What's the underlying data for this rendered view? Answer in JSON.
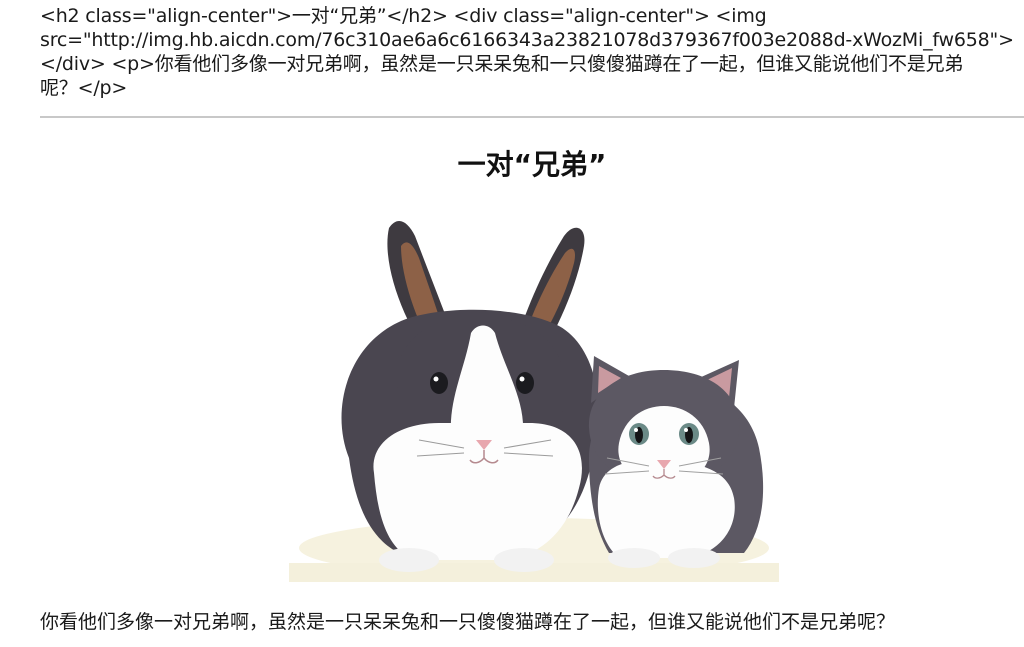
{
  "source": {
    "line1": "<h2 class=\"align-center\">一对“兄弟”</h2> <div class=\"align-center\"> <img",
    "line2": "src=\"http://img.hb.aicdn.com/76c310ae6a6c6166343a23821078d379367f003e2088d-xWozMi_fw658\">",
    "line3": "</div> <p>你看他们多像一对兄弟啊，虽然是一只呆呆兔和一只傻傻猫蹲在了一起，但谁又能说他们不是兄弟",
    "line4": "呢？</p>"
  },
  "preview": {
    "title": "一对“兄弟”",
    "paragraph": "你看他们多像一对兄弟啊，虽然是一只呆呆兔和一只傻傻猫蹲在了一起，但谁又能说他们不是兄弟呢？"
  },
  "colors": {
    "divider": "#c8c8c8",
    "fur_dark": "#4a4650",
    "fur_white": "#fdfdfd",
    "nose_pink": "#e8a7ae"
  }
}
